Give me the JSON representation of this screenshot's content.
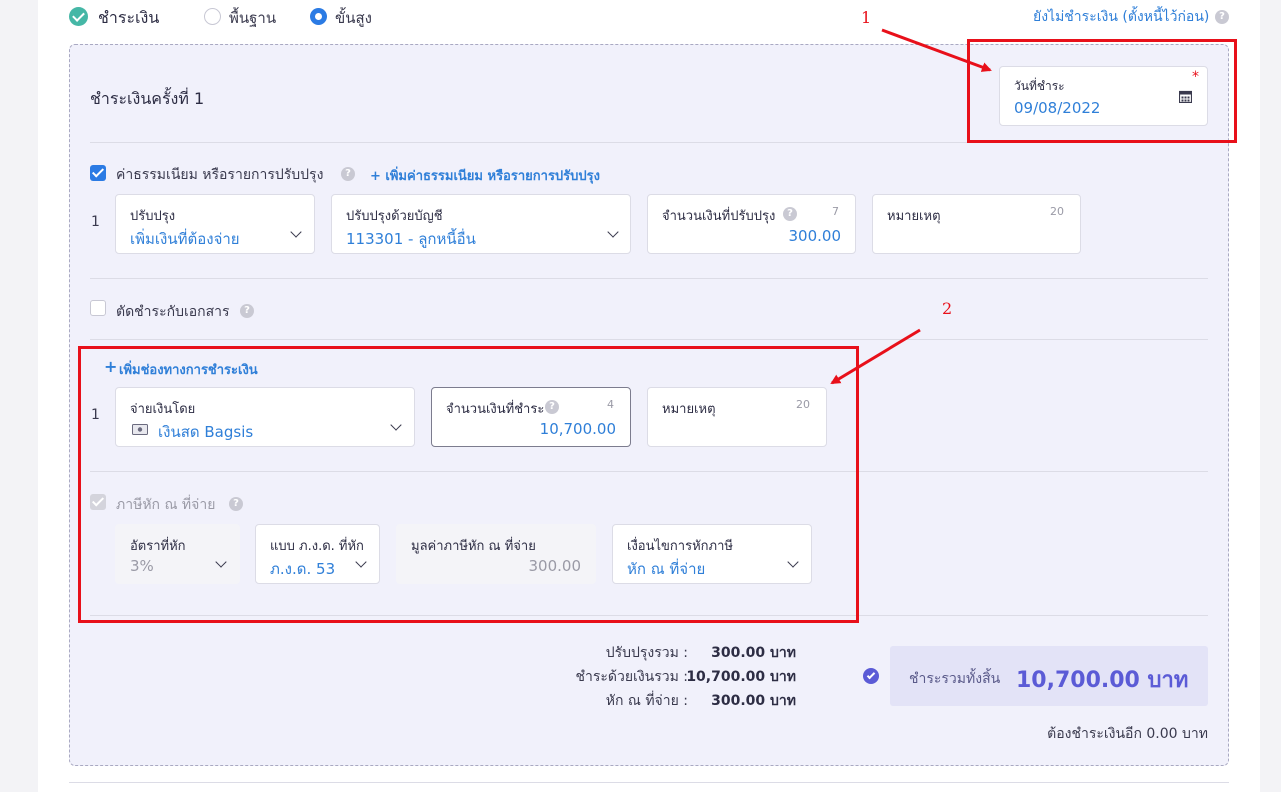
{
  "header": {
    "title": "ชำระเงิน",
    "mode_basic": "พื้นฐาน",
    "mode_advanced": "ขั้นสูง",
    "unpaid_link": "ยังไม่ชำระเงิน (ตั้งหนี้ไว้ก่อน)"
  },
  "payment": {
    "heading": "ชำระเงินครั้งที่ 1",
    "date_label": "วันที่ชำระ",
    "date_value": "09/08/2022",
    "required_mark": "*"
  },
  "fees": {
    "checkbox_label": "ค่าธรรมเนียม หรือรายการปรับปรุง",
    "add_link": "+ เพิ่มค่าธรรมเนียม หรือรายการปรับปรุง",
    "row_num": "1",
    "adjust_label": "ปรับปรุง",
    "adjust_value": "เพิ่มเงินที่ต้องจ่าย",
    "account_label": "ปรับปรุงด้วยบัญชี",
    "account_value": "113301 - ลูกหนี้อื่น",
    "amount_label": "จำนวนเงินที่ปรับปรุง",
    "amount_count": "7",
    "amount_value": "300.00",
    "note_label": "หมายเหตุ",
    "note_count": "20"
  },
  "offset": {
    "checkbox_label": "ตัดชำระกับเอกสาร"
  },
  "channel": {
    "add_link": "เพิ่มช่องทางการชำระเงิน",
    "row_num": "1",
    "payby_label": "จ่ายเงินโดย",
    "payby_value": "เงินสด Bagsis",
    "amount_label": "จำนวนเงินที่ชำระ",
    "amount_count": "4",
    "amount_value": "10,700.00",
    "note_label": "หมายเหตุ",
    "note_count": "20"
  },
  "wht": {
    "checkbox_label": "ภาษีหัก ณ ที่จ่าย",
    "rate_label": "อัตราที่หัก",
    "rate_value": "3%",
    "form_label": "แบบ ภ.ง.ด. ที่หัก",
    "form_value": "ภ.ง.ด. 53",
    "base_label": "มูลค่าภาษีหัก ณ ที่จ่าย",
    "base_value": "300.00",
    "cond_label": "เงื่อนไขการหักภาษี",
    "cond_value": "หัก ณ ที่จ่าย"
  },
  "summary": {
    "adjust_label": "ปรับปรุงรวม :",
    "adjust_value": "300.00 บาท",
    "paid_label": "ชำระด้วยเงินรวม :",
    "paid_value": "10,700.00 บาท",
    "wht_label": "หัก ณ ที่จ่าย :",
    "wht_value": "300.00 บาท",
    "total_label": "ชำระรวมทั้งสิ้น",
    "total_value": "10,700.00 บาท",
    "remaining": "ต้องชำระเงินอีก 0.00 บาท"
  },
  "annotations": {
    "one": "1",
    "two": "2"
  },
  "colors": {
    "accent": "#2f7fd8",
    "annotation": "#e8101a",
    "success": "#45b7a6"
  }
}
